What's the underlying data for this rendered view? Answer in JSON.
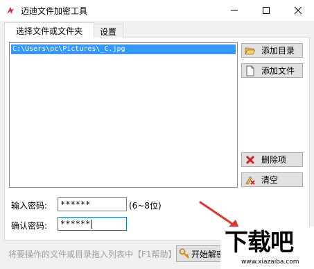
{
  "window": {
    "title": "迈迪文件加密工具",
    "minimize_icon": "minimize-icon",
    "maximize_icon": "maximize-icon",
    "close_icon": "close-icon"
  },
  "tabs": [
    {
      "label": "选择文件或文件夹",
      "active": true
    },
    {
      "label": "设置",
      "active": false
    }
  ],
  "file_list": {
    "items": [
      "C:\\Users\\pc\\Pictures\\_C.jpg"
    ]
  },
  "buttons": {
    "add_dir": {
      "label": "添加目录",
      "icon": "folder-open-icon"
    },
    "add_file": {
      "label": "添加文件",
      "icon": "file-icon"
    },
    "remove": {
      "label": "删除项",
      "icon": "delete-icon"
    },
    "clear": {
      "label": "清空",
      "icon": "clear-icon"
    },
    "start": {
      "label": "开始解密",
      "icon": "key-icon"
    }
  },
  "password": {
    "label": "输入密码:",
    "value": "******",
    "hint": "(6~8位)"
  },
  "confirm": {
    "label": "确认密码:",
    "value": "******"
  },
  "status": {
    "text": "将要操作的文件或目录拖入列表中【F1帮助】"
  },
  "watermark": {
    "text": "下载吧",
    "url": "www.xiazaiba.com"
  },
  "colors": {
    "selection": "#3399ff",
    "focus_border": "#0078d7",
    "arrow": "#e0342c"
  }
}
